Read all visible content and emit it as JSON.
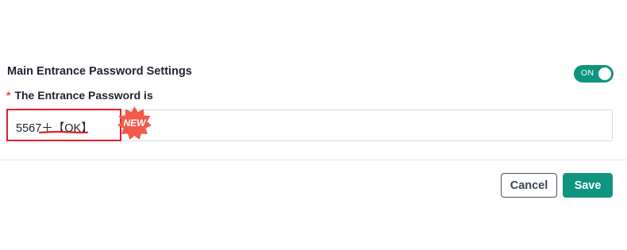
{
  "section": {
    "title": "Main Entrance Password Settings"
  },
  "toggle": {
    "label": "ON",
    "state": "on",
    "color": "#0f9480"
  },
  "field": {
    "required_mark": "*",
    "label": "The Entrance Password is",
    "value": "5567＋【OK】",
    "highlight_color": "#e0202a"
  },
  "badge": {
    "label": "NEW",
    "color": "#f25a4a"
  },
  "actions": {
    "cancel_label": "Cancel",
    "save_label": "Save"
  }
}
